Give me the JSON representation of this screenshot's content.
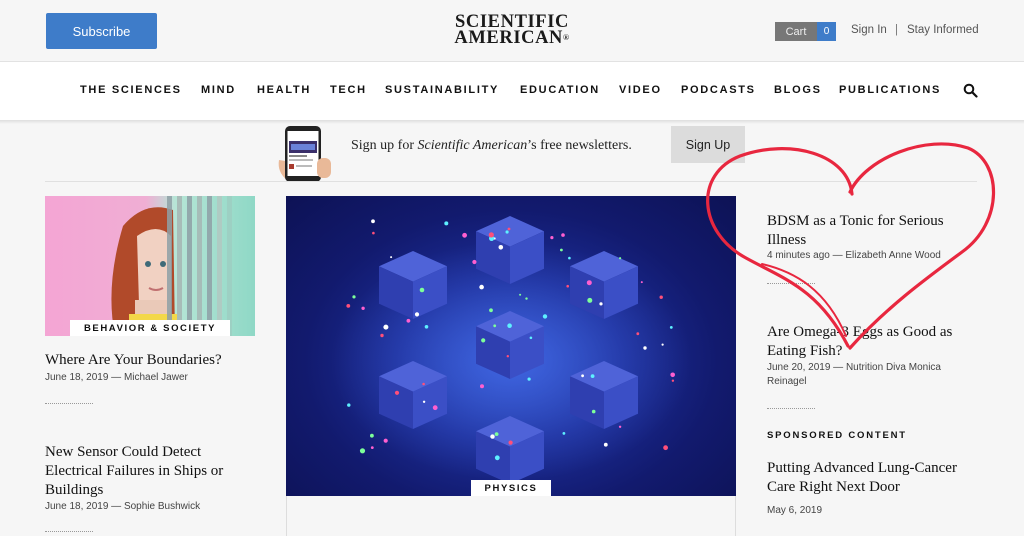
{
  "header": {
    "subscribe_label": "Subscribe",
    "logo_line1": "SCIENTIFIC",
    "logo_line2": "AMERICAN",
    "logo_mark": "®",
    "cart_label": "Cart",
    "cart_count": "0",
    "signin_label": "Sign In",
    "divider": "|",
    "stay_label": "Stay Informed"
  },
  "nav": {
    "items": [
      "THE SCIENCES",
      "MIND",
      "HEALTH",
      "TECH",
      "SUSTAINABILITY",
      "EDUCATION",
      "VIDEO",
      "PODCASTS",
      "BLOGS",
      "PUBLICATIONS"
    ]
  },
  "newsletter": {
    "text_before": "Sign up for ",
    "text_italic": "Scientific American",
    "text_after": "’s free newsletters.",
    "signup_label": "Sign Up"
  },
  "left": {
    "feature_tag": "BEHAVIOR & SOCIETY",
    "articles": [
      {
        "title": "Where Are Your Boundaries?",
        "meta": "June 18, 2019 — Michael Jawer"
      },
      {
        "title": "New Sensor Could Detect Electrical Failures in Ships or Buildings",
        "meta": "June 18, 2019 — Sophie Bushwick"
      }
    ]
  },
  "main": {
    "tag": "PHYSICS"
  },
  "right": {
    "articles": [
      {
        "title": "BDSM as a Tonic for Serious Illness",
        "meta": "4 minutes ago — Elizabeth Anne Wood"
      },
      {
        "title": "Are Omega-3 Eggs as Good as Eating Fish?",
        "meta": "June 20, 2019 — Nutrition Diva Monica Reinagel"
      }
    ],
    "sponsored_label": "SPONSORED CONTENT",
    "sponsored": {
      "title": "Putting Advanced Lung-Cancer Care Right Next Door",
      "meta": "May 6, 2019"
    }
  },
  "colors": {
    "accent_blue": "#3e7cc9",
    "heart_red": "#e8273f"
  }
}
